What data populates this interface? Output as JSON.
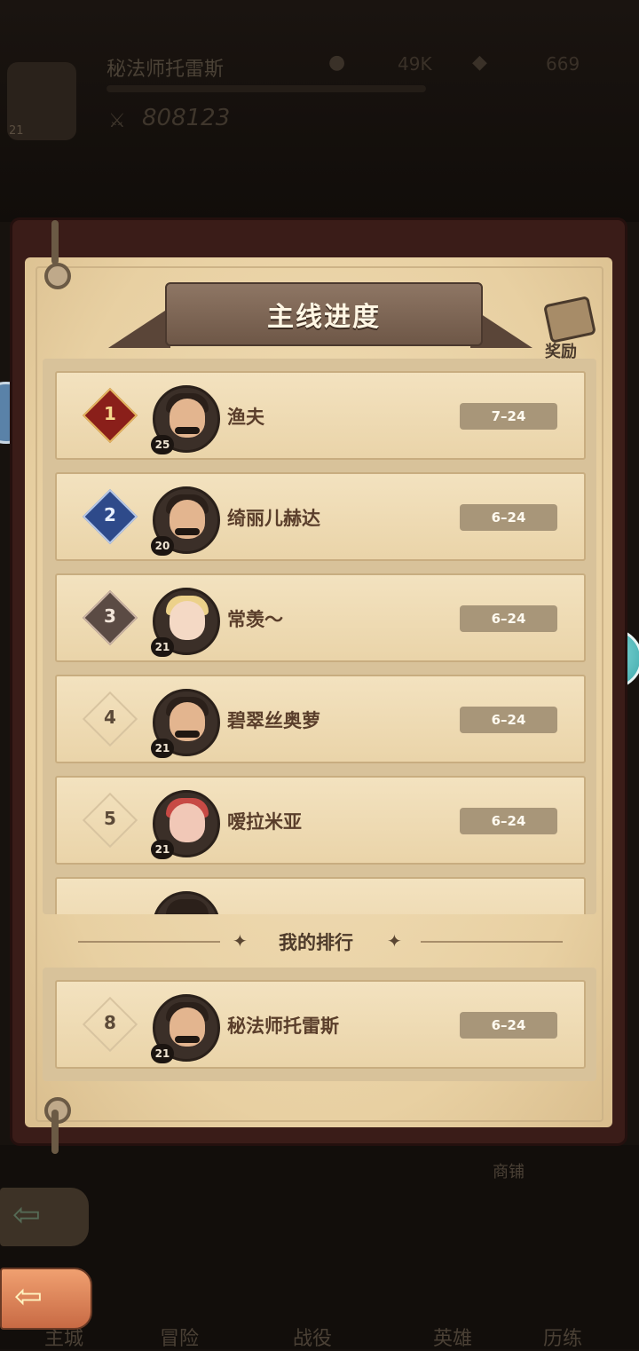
{
  "hud": {
    "player_name": "秘法师托雷斯",
    "level": "21",
    "power": "808123",
    "resource_1": "49K",
    "resource_2": "669"
  },
  "panel": {
    "title": "主线进度",
    "reward_label": "奖励",
    "my_rank_label": "我的排行"
  },
  "rankings": [
    {
      "rank": "1",
      "name": "渔夫",
      "level": "25",
      "stage": "7–24",
      "avatar": "man"
    },
    {
      "rank": "2",
      "name": "绮丽儿赫达",
      "level": "20",
      "stage": "6–24",
      "avatar": "man"
    },
    {
      "rank": "3",
      "name": "常羡～",
      "level": "21",
      "stage": "6–24",
      "avatar": "blonde"
    },
    {
      "rank": "4",
      "name": "碧翠丝奥萝",
      "level": "21",
      "stage": "6–24",
      "avatar": "man"
    },
    {
      "rank": "5",
      "name": "嗳拉米亚",
      "level": "21",
      "stage": "6–24",
      "avatar": "red"
    }
  ],
  "my_rank": {
    "rank": "8",
    "name": "秘法师托雷斯",
    "level": "21",
    "stage": "6–24",
    "avatar": "man"
  },
  "bottom_nav": {
    "shop_label": "商铺",
    "items": [
      "主城",
      "冒险",
      "战役",
      "英雄",
      "历练"
    ]
  },
  "icons": {
    "reward": "chest-icon",
    "rocket": "rocket-icon",
    "back": "back-arrow-icon"
  }
}
